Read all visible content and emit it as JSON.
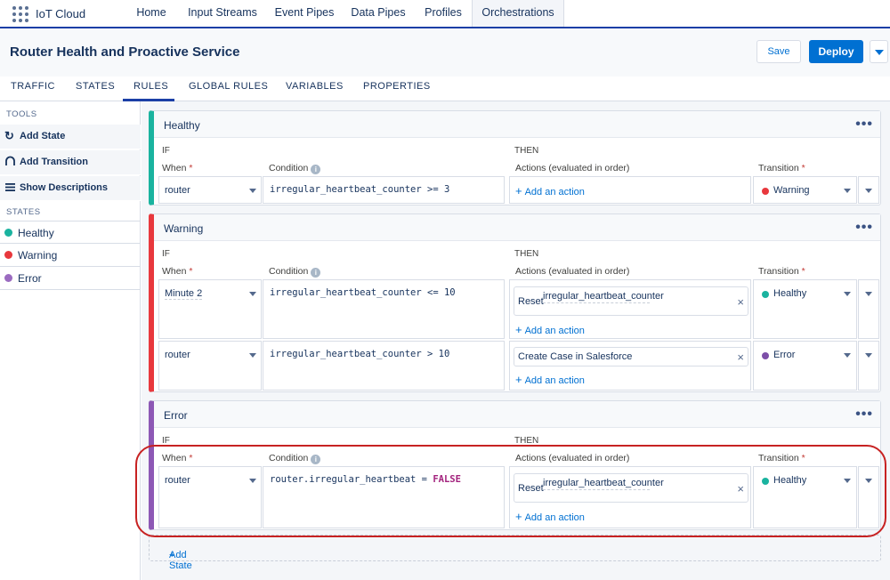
{
  "app": {
    "name": "IoT Cloud"
  },
  "nav": {
    "items": [
      {
        "label": "Home"
      },
      {
        "label": "Input Streams"
      },
      {
        "label": "Event Pipes"
      },
      {
        "label": "Data Pipes"
      },
      {
        "label": "Profiles"
      },
      {
        "label": "Orchestrations",
        "active": true
      }
    ]
  },
  "header": {
    "title": "Router Health and Proactive Service",
    "save_label": "Save",
    "deploy_label": "Deploy"
  },
  "tabs": [
    {
      "label": "TRAFFIC"
    },
    {
      "label": "STATES"
    },
    {
      "label": "RULES",
      "active": true
    },
    {
      "label": "GLOBAL RULES"
    },
    {
      "label": "VARIABLES"
    },
    {
      "label": "PROPERTIES"
    }
  ],
  "sidebar": {
    "tools_title": "TOOLS",
    "tools": [
      {
        "label": "Add State",
        "icon": "rotate-icon"
      },
      {
        "label": "Add Transition",
        "icon": "arc-icon"
      },
      {
        "label": "Show Descriptions",
        "icon": "list-icon"
      }
    ],
    "states_title": "STATES",
    "states": [
      {
        "label": "Healthy",
        "color": "#1ab39f"
      },
      {
        "label": "Warning",
        "color": "#e8383d"
      },
      {
        "label": "Error",
        "color": "#9b6bc0"
      }
    ]
  },
  "labels": {
    "if": "IF",
    "then": "THEN",
    "when": "When",
    "condition": "Condition",
    "actions": "Actions (evaluated in order)",
    "transition": "Transition",
    "required": "*",
    "info": "i",
    "add_action": "Add an action",
    "add_state": "Add State",
    "plus": "+",
    "remove": "×",
    "menu": "•••"
  },
  "states": [
    {
      "name": "Healthy",
      "color": "#1ab39f",
      "rules": [
        {
          "when": "router",
          "condition": "irregular_heartbeat_counter >= 3",
          "actions": [],
          "transition": "Warning",
          "transition_color": "#e8383d"
        }
      ]
    },
    {
      "name": "Warning",
      "color": "#e8383d",
      "rules": [
        {
          "when": "Minute 2",
          "condition": "irregular_heartbeat_counter <= 10",
          "action_prefix": "Reset",
          "action_value": "irregular_heartbeat_counter",
          "transition": "Healthy",
          "transition_color": "#1ab39f"
        },
        {
          "when": "router",
          "condition": "irregular_heartbeat_counter > 10",
          "action_value": "Create Case in Salesforce",
          "transition": "Error",
          "transition_color": "#7d4fa8"
        }
      ]
    },
    {
      "name": "Error",
      "color": "#8d58b5",
      "rules": [
        {
          "when": "router",
          "condition_prefix": "router.irregular_heartbeat = ",
          "condition_keyword": "FALSE",
          "action_prefix": "Reset",
          "action_value": "irregular_heartbeat_counter",
          "transition": "Healthy",
          "transition_color": "#1ab39f"
        }
      ]
    }
  ],
  "colors": {
    "brand": "#0070d2",
    "nav_underline": "#1b3fa6",
    "highlight": "#c72222"
  }
}
